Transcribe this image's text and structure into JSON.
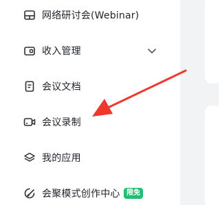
{
  "sidebar": {
    "items": [
      {
        "label": "网络研讨会(Webinar)",
        "icon": "webinar-icon"
      },
      {
        "label": "收入管理",
        "icon": "wallet-icon",
        "expandable": true
      },
      {
        "label": "会议文档",
        "icon": "document-icon"
      },
      {
        "label": "会议录制",
        "icon": "video-camera-icon"
      },
      {
        "label": "我的应用",
        "icon": "layers-icon"
      },
      {
        "label": "会聚模式创作中心",
        "icon": "creator-icon",
        "badge": "限免"
      }
    ]
  },
  "colors": {
    "text": "#1f2329",
    "icon": "#2b2f36",
    "badge_bg": "#20c073",
    "arrow": "#f0372b",
    "panel_bg": "#f2f3f5"
  }
}
